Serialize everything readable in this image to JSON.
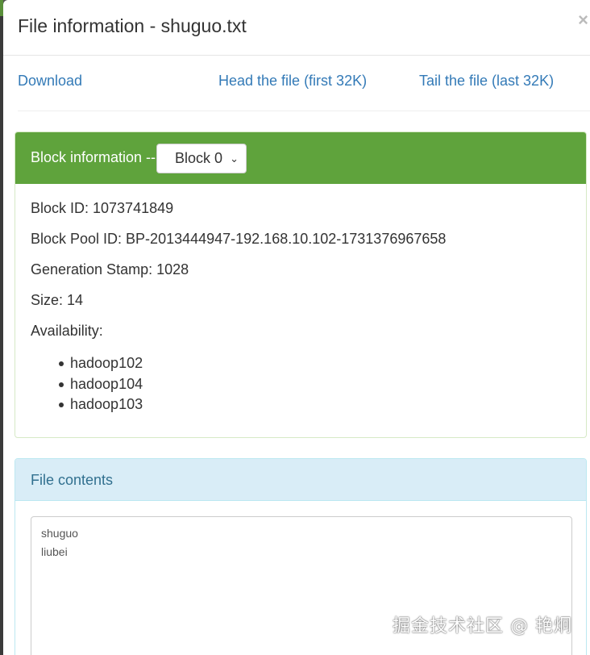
{
  "dialog": {
    "title": "File information - shuguo.txt",
    "close_symbol": "×"
  },
  "links": {
    "download": "Download",
    "head": "Head the file (first 32K)",
    "tail": "Tail the file (last 32K)"
  },
  "block_panel": {
    "heading": "Block information --",
    "selected_block": "Block 0",
    "block_id": "Block ID: 1073741849",
    "block_pool_id": "Block Pool ID: BP-2013444947-192.168.10.102-1731376967658",
    "generation_stamp": "Generation Stamp: 1028",
    "size": "Size: 14",
    "availability_label": "Availability:",
    "availability": [
      "hadoop102",
      "hadoop104",
      "hadoop103"
    ]
  },
  "file_panel": {
    "heading": "File contents",
    "contents": "shuguo\nliubei"
  },
  "watermark": "掘金技术社区 @ 艳炯",
  "colors": {
    "block_heading_bg": "#5fa33c",
    "file_heading_bg": "#d9edf7",
    "link": "#337ab7"
  }
}
